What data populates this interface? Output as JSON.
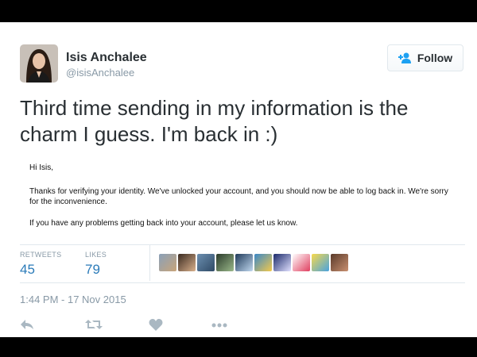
{
  "user": {
    "name": "Isis Anchalee",
    "handle": "@isisAnchalee"
  },
  "follow_button": {
    "label": "Follow"
  },
  "tweet_text": "Third time sending in my information is the charm I guess. I'm back in :)",
  "email": {
    "greeting": "Hi Isis,",
    "paragraph1": "Thanks for verifying your identity. We've unlocked your account, and you should now be able to log back in. We're sorry for the inconvenience.",
    "paragraph2": "If you have any problems getting back into your account, please let us know."
  },
  "stats": {
    "retweets_label": "RETWEETS",
    "retweets_value": "45",
    "likes_label": "LIKES",
    "likes_value": "79"
  },
  "likers_count_shown": 10,
  "timestamp": "1:44 PM - 17 Nov 2015",
  "actions": [
    "reply-icon",
    "retweet-icon",
    "like-icon",
    "more-icon"
  ],
  "colors": {
    "link": "#2b7bb9",
    "follow_icon": "#1da1f2",
    "muted": "#8899a6",
    "text": "#292f33",
    "action_icon": "#aab8c2"
  }
}
